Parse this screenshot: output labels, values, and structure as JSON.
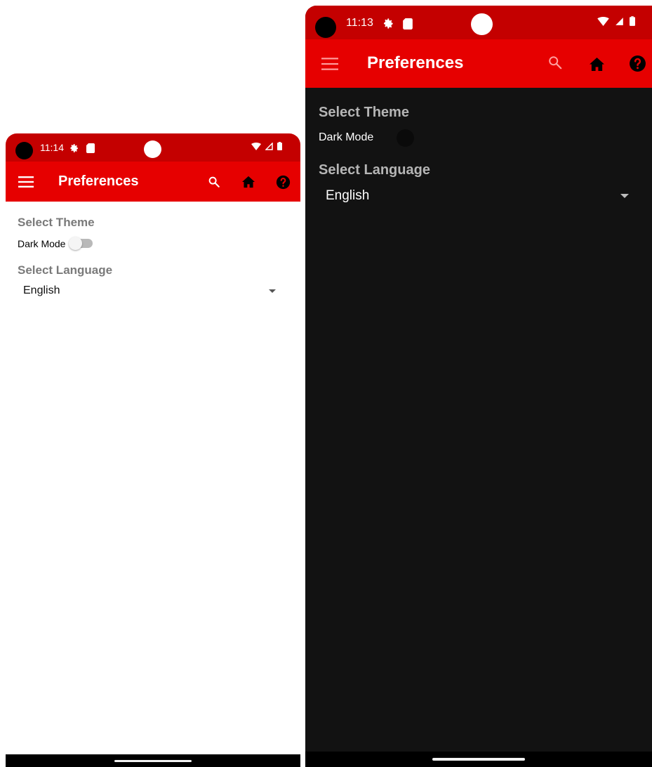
{
  "screens": [
    {
      "id": "light",
      "status": {
        "time": "11:14"
      },
      "appbar": {
        "title": "Preferences"
      },
      "content": {
        "theme_section_title": "Select Theme",
        "dark_mode_label": "Dark Mode",
        "dark_mode_enabled": false,
        "language_section_title": "Select Language",
        "language_selected": "English"
      },
      "colors": {
        "statusbar": "#c40000",
        "appbar": "#e60000",
        "background": "#ffffff"
      }
    },
    {
      "id": "dark",
      "status": {
        "time": "11:13"
      },
      "appbar": {
        "title": "Preferences"
      },
      "content": {
        "theme_section_title": "Select Theme",
        "dark_mode_label": "Dark Mode",
        "dark_mode_enabled": true,
        "language_section_title": "Select Language",
        "language_selected": "English"
      },
      "colors": {
        "statusbar": "#c40000",
        "appbar": "#e60000",
        "background": "#121212"
      }
    }
  ],
  "icons": [
    "menu-icon",
    "search-icon",
    "home-icon",
    "help-icon",
    "gear-icon",
    "sd-card-icon",
    "wifi-icon",
    "signal-icon",
    "battery-icon"
  ]
}
